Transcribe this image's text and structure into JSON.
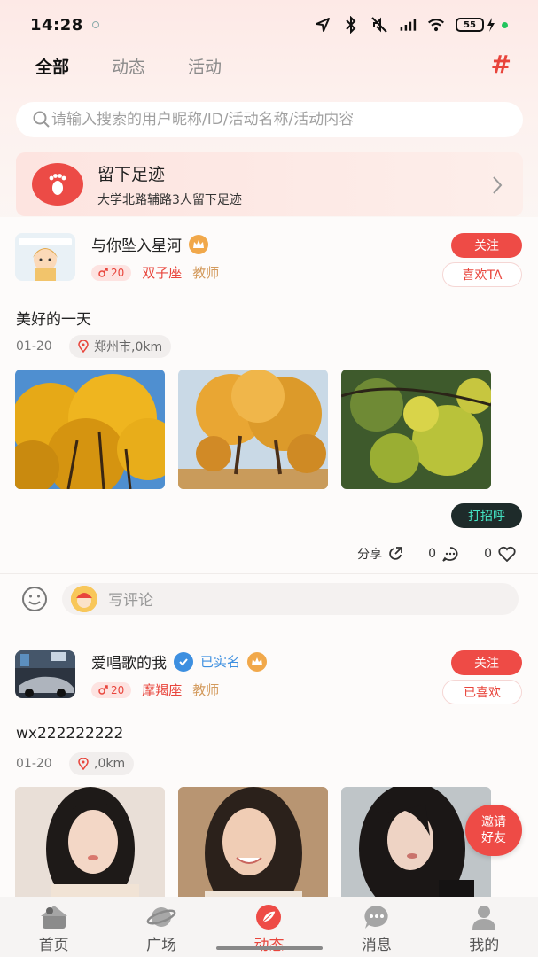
{
  "status_bar": {
    "time": "14:28",
    "battery": "55"
  },
  "tabs": [
    {
      "label": "全部",
      "active": true
    },
    {
      "label": "动态",
      "active": false
    },
    {
      "label": "活动",
      "active": false
    }
  ],
  "search": {
    "placeholder": "请输入搜索的用户昵称/ID/活动名称/活动内容"
  },
  "footprint": {
    "title": "留下足迹",
    "subtitle": "大学北路辅路3人留下足迹"
  },
  "posts": [
    {
      "username": "与你坠入星河",
      "gender_age": "20",
      "zodiac": "双子座",
      "job": "教师",
      "follow_label": "关注",
      "like_label": "喜欢TA",
      "content": "美好的一天",
      "date": "01-20",
      "location": "郑州市,0km",
      "greet_label": "打招呼",
      "share_label": "分享",
      "comment_count": "0",
      "like_count": "0",
      "comment_placeholder": "写评论"
    },
    {
      "username": "爱唱歌的我",
      "verified_label": "已实名",
      "gender_age": "20",
      "zodiac": "摩羯座",
      "job": "教师",
      "follow_label": "关注",
      "like_label": "已喜欢",
      "content": "wx222222222",
      "date": "01-20",
      "location": ",0km"
    }
  ],
  "invite": {
    "line1": "邀请",
    "line2": "好友"
  },
  "bottom_nav": [
    {
      "label": "首页",
      "icon": "home-icon"
    },
    {
      "label": "广场",
      "icon": "planet-icon"
    },
    {
      "label": "动态",
      "icon": "feather-icon",
      "active": true
    },
    {
      "label": "消息",
      "icon": "message-icon"
    },
    {
      "label": "我的",
      "icon": "profile-icon"
    }
  ],
  "colors": {
    "accent": "#ee4b46",
    "verified": "#3d8fe0",
    "job": "#d39a5c"
  }
}
